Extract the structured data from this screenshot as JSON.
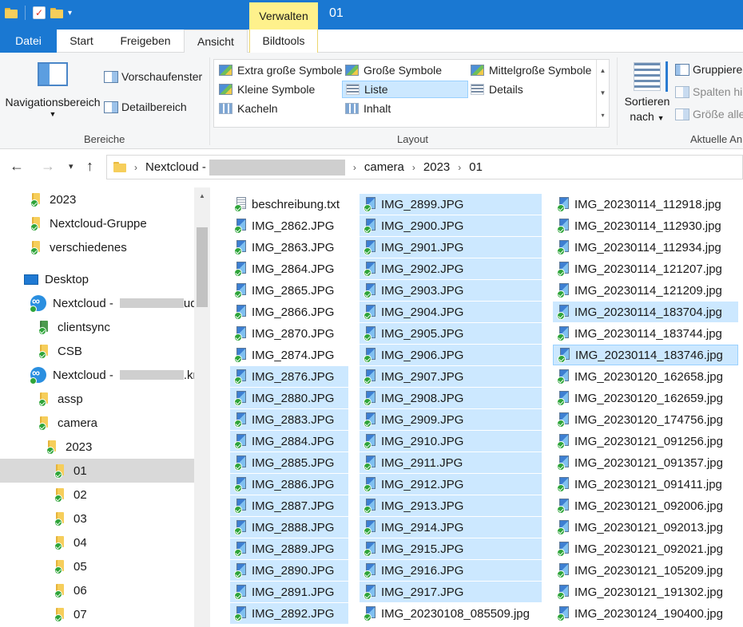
{
  "titlebar": {
    "context_tab": "Verwalten",
    "window_title": "01"
  },
  "tabs": {
    "file": "Datei",
    "start": "Start",
    "share": "Freigeben",
    "view": "Ansicht",
    "picture_tools": "Bildtools"
  },
  "ribbon": {
    "panes": {
      "nav_pane": "Navigationsbereich",
      "preview_pane": "Vorschaufenster",
      "details_pane": "Detailbereich",
      "label": "Bereiche"
    },
    "layout": {
      "extra_large": "Extra große Symbole",
      "large": "Große Symbole",
      "medium": "Mittelgroße Symbole",
      "small": "Kleine Symbole",
      "list": "Liste",
      "details": "Details",
      "tiles": "Kacheln",
      "content": "Inhalt",
      "label": "Layout"
    },
    "current_view": {
      "sort_line1": "Sortieren",
      "sort_line2": "nach",
      "group": "Gruppieren",
      "add_columns": "Spalten hin",
      "size_all": "Größe aller",
      "label": "Aktuelle An"
    }
  },
  "address": {
    "root": "Nextcloud -",
    "crumbs": [
      "camera",
      "2023",
      "01"
    ]
  },
  "tree": {
    "items": [
      {
        "label": "2023"
      },
      {
        "label": "Nextcloud-Gruppe"
      },
      {
        "label": "verschiedenes"
      },
      {
        "label": "Desktop"
      },
      {
        "label": "Nextcloud -",
        "suffix": "ud"
      },
      {
        "label": "clientsync"
      },
      {
        "label": "CSB"
      },
      {
        "label": "Nextcloud -",
        "suffix": ".kr"
      },
      {
        "label": "assp"
      },
      {
        "label": "camera"
      },
      {
        "label": "2023"
      },
      {
        "label": "01"
      },
      {
        "label": "02"
      },
      {
        "label": "03"
      },
      {
        "label": "04"
      },
      {
        "label": "05"
      },
      {
        "label": "06"
      },
      {
        "label": "07"
      }
    ]
  },
  "files": {
    "col1": [
      "beschreibung.txt",
      "IMG_2862.JPG",
      "IMG_2863.JPG",
      "IMG_2864.JPG",
      "IMG_2865.JPG",
      "IMG_2866.JPG",
      "IMG_2870.JPG",
      "IMG_2874.JPG",
      "IMG_2876.JPG",
      "IMG_2880.JPG",
      "IMG_2883.JPG",
      "IMG_2884.JPG",
      "IMG_2885.JPG",
      "IMG_2886.JPG",
      "IMG_2887.JPG",
      "IMG_2888.JPG",
      "IMG_2889.JPG",
      "IMG_2890.JPG",
      "IMG_2891.JPG",
      "IMG_2892.JPG"
    ],
    "col2": [
      "IMG_2899.JPG",
      "IMG_2900.JPG",
      "IMG_2901.JPG",
      "IMG_2902.JPG",
      "IMG_2903.JPG",
      "IMG_2904.JPG",
      "IMG_2905.JPG",
      "IMG_2906.JPG",
      "IMG_2907.JPG",
      "IMG_2908.JPG",
      "IMG_2909.JPG",
      "IMG_2910.JPG",
      "IMG_2911.JPG",
      "IMG_2912.JPG",
      "IMG_2913.JPG",
      "IMG_2914.JPG",
      "IMG_2915.JPG",
      "IMG_2916.JPG",
      "IMG_2917.JPG",
      "IMG_20230108_085509.jpg"
    ],
    "col3": [
      "IMG_20230114_112918.jpg",
      "IMG_20230114_112930.jpg",
      "IMG_20230114_112934.jpg",
      "IMG_20230114_121207.jpg",
      "IMG_20230114_121209.jpg",
      "IMG_20230114_183704.jpg",
      "IMG_20230114_183744.jpg",
      "IMG_20230114_183746.jpg",
      "IMG_20230120_162658.jpg",
      "IMG_20230120_162659.jpg",
      "IMG_20230120_174756.jpg",
      "IMG_20230121_091256.jpg",
      "IMG_20230121_091357.jpg",
      "IMG_20230121_091411.jpg",
      "IMG_20230121_092006.jpg",
      "IMG_20230121_092013.jpg",
      "IMG_20230121_092021.jpg",
      "IMG_20230121_105209.jpg",
      "IMG_20230121_191302.jpg",
      "IMG_20230124_190400.jpg"
    ]
  }
}
